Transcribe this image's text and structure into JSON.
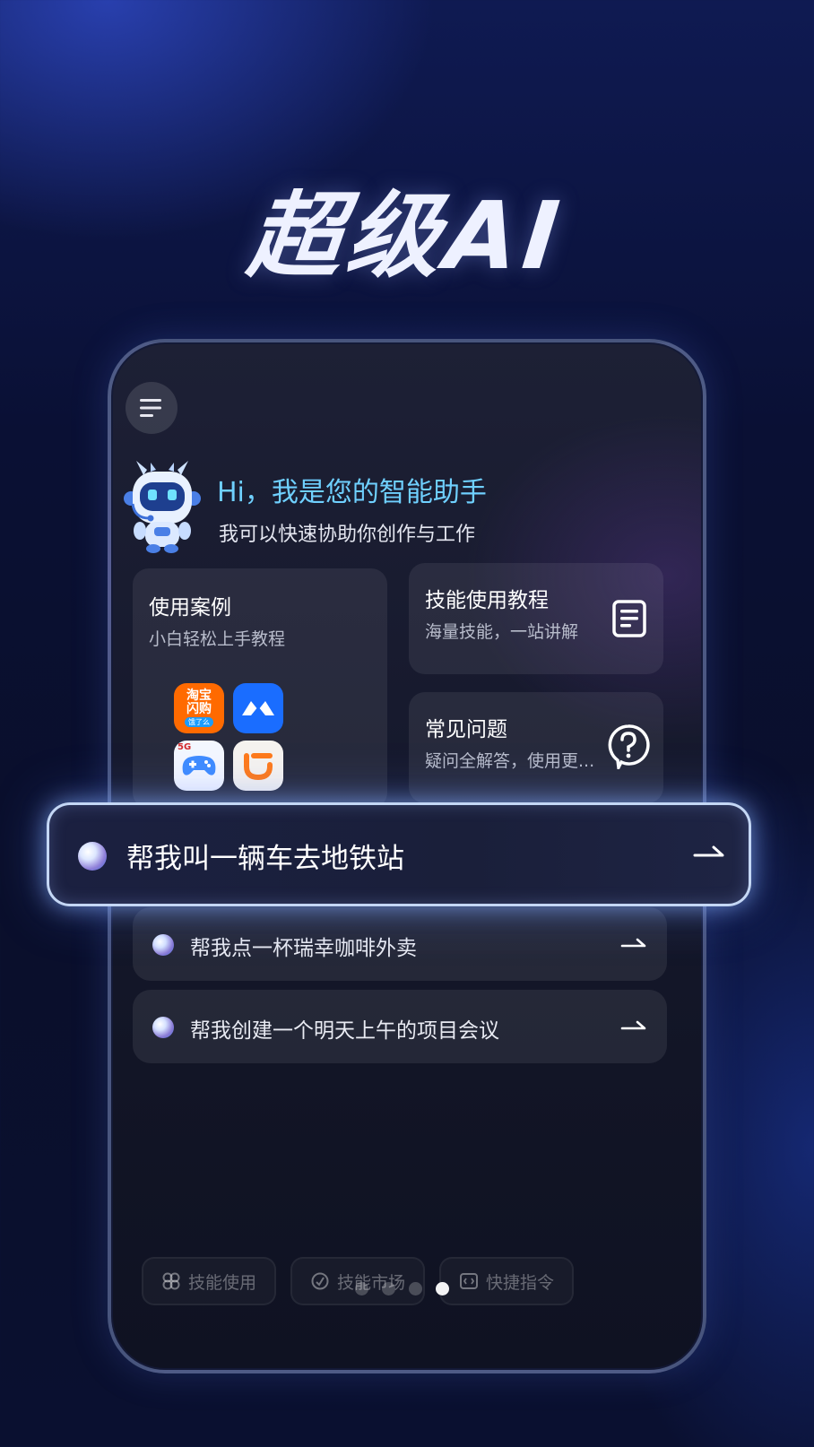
{
  "banner": {
    "title": "超级AI"
  },
  "assistant": {
    "greeting": "Hi，我是您的智能助手",
    "subtitle": "我可以快速协助你创作与工作"
  },
  "cards": {
    "use_cases": {
      "title": "使用案例",
      "subtitle": "小白轻松上手教程",
      "apps": [
        {
          "label_line1": "淘宝",
          "label_line2": "闪购",
          "badge": "饿了么",
          "icon": "taobao-shangou-app-icon"
        },
        {
          "icon": "feishu-app-icon"
        },
        {
          "badge": "5G",
          "icon": "game-controller-app-icon"
        },
        {
          "icon": "didi-app-icon"
        }
      ]
    },
    "tutorial": {
      "title": "技能使用教程",
      "subtitle": "海量技能，一站讲解",
      "icon": "document-icon"
    },
    "faq": {
      "title": "常见问题",
      "subtitle": "疑问全解答，使用更...",
      "icon": "question-icon"
    }
  },
  "suggestions": [
    {
      "text": "帮我叫一辆车去地铁站"
    },
    {
      "text": "帮我点一杯瑞幸咖啡外卖"
    },
    {
      "text": "帮我创建一个明天上午的项目会议"
    }
  ],
  "bottom_tabs": [
    {
      "label": "技能使用",
      "icon": "skills-icon"
    },
    {
      "label": "技能市场",
      "icon": "market-icon"
    },
    {
      "label": "快捷指令",
      "icon": "command-icon"
    }
  ],
  "pager": {
    "count": 4,
    "active_index": 3
  },
  "colors": {
    "greeting": "#6fd0ff",
    "taobao_orange": "#ff6a00",
    "feishu_blue": "#1a6dff",
    "didi_orange": "#ff7a1a"
  }
}
